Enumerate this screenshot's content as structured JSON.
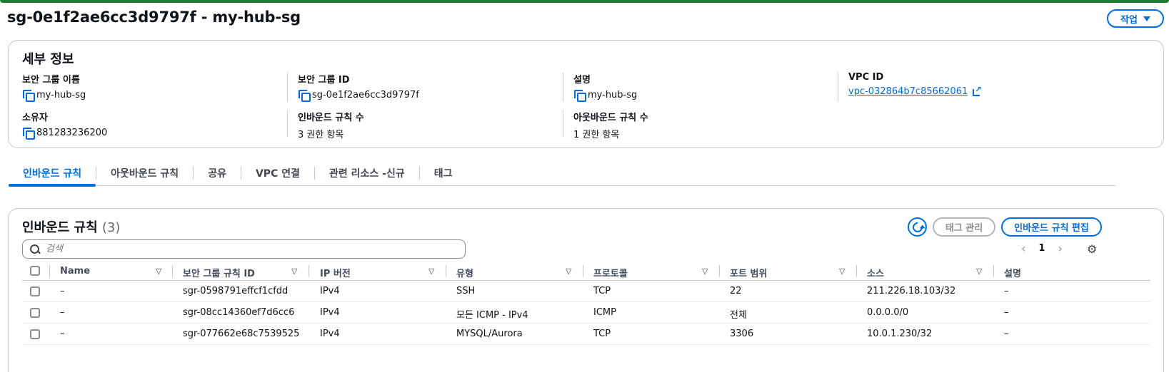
{
  "header": {
    "title": "sg-0e1f2ae6cc3d9797f - my-hub-sg",
    "actions_label": "작업"
  },
  "details": {
    "heading": "세부 정보",
    "sg_name_label": "보안 그룹 이름",
    "sg_name_value": "my-hub-sg",
    "sg_id_label": "보안 그룹 ID",
    "sg_id_value": "sg-0e1f2ae6cc3d9797f",
    "desc_label": "설명",
    "desc_value": "my-hub-sg",
    "vpc_label": "VPC ID",
    "vpc_value": "vpc-032864b7c85662061",
    "owner_label": "소유자",
    "owner_value": "881283236200",
    "inbound_count_label": "인바운드 규칙 수",
    "inbound_count_value": "3 권한 항목",
    "outbound_count_label": "아웃바운드 규칙 수",
    "outbound_count_value": "1 권한 항목"
  },
  "tabs": [
    {
      "label": "인바운드 규칙",
      "active": true
    },
    {
      "label": "아웃바운드 규칙"
    },
    {
      "label": "공유"
    },
    {
      "label": "VPC 연결"
    },
    {
      "label": "관련 리소스 -신규"
    },
    {
      "label": "태그"
    }
  ],
  "rules": {
    "heading": "인바운드 규칙",
    "count": "(3)",
    "tag_manage_label": "태그 관리",
    "edit_label": "인바운드 규칙 편집",
    "search_placeholder": "검색",
    "page": "1",
    "columns": [
      "Name",
      "보안 그룹 규칙 ID",
      "IP 버전",
      "유형",
      "프로토콜",
      "포트 범위",
      "소스",
      "설명"
    ],
    "rows": [
      [
        "–",
        "sgr-0598791effcf1cfdd",
        "IPv4",
        "SSH",
        "TCP",
        "22",
        "211.226.18.103/32",
        "–"
      ],
      [
        "–",
        "sgr-08cc14360ef7d6cc6",
        "IPv4",
        "모든 ICMP - IPv4",
        "ICMP",
        "전체",
        "0.0.0.0/0",
        "–"
      ],
      [
        "–",
        "sgr-077662e68c7539525",
        "IPv4",
        "MYSQL/Aurora",
        "TCP",
        "3306",
        "10.0.1.230/32",
        "–"
      ]
    ]
  },
  "colors": {
    "accent": "#006ce0",
    "success_bar": "#1b7d32",
    "border": "#c6c6cd"
  },
  "icons": [
    "copy-icon",
    "external-link-icon",
    "refresh-icon",
    "search-icon",
    "chevron-left-icon",
    "chevron-right-icon",
    "gear-icon",
    "sort-icon",
    "caret-down-icon"
  ]
}
